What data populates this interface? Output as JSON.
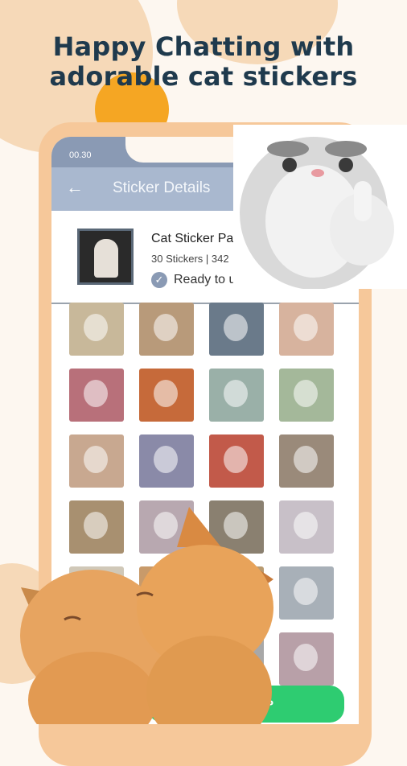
{
  "headline": {
    "line1": "Happy Chatting with",
    "line2": "adorable cat stickers"
  },
  "status": {
    "time": "00.30"
  },
  "appbar": {
    "back_icon": "←",
    "title": "Sticker Details"
  },
  "pack": {
    "name": "Cat Sticker Pa",
    "meta": "30 Stickers | 342",
    "ready": "Ready to u"
  },
  "button": {
    "label": "PP"
  },
  "colors": {
    "accent": "#2ecc71",
    "phone": "#f6c89a",
    "appbar": "#a9b8cf",
    "headline": "#1f3a4d"
  },
  "stickers": [
    {
      "color": "#c8b89a"
    },
    {
      "color": "#b89a7a"
    },
    {
      "color": "#6a7a8a"
    },
    {
      "color": "#d7b39e"
    },
    {
      "color": "#b8707a"
    },
    {
      "color": "#c66a3a"
    },
    {
      "color": "#9ab0a8"
    },
    {
      "color": "#a4b89a"
    },
    {
      "color": "#c8a890"
    },
    {
      "color": "#8a8aa8"
    },
    {
      "color": "#c25a4a"
    },
    {
      "color": "#9a8a7a"
    },
    {
      "color": "#a89070"
    },
    {
      "color": "#b8a8b0"
    },
    {
      "color": "#8a8070"
    },
    {
      "color": "#c8c0c8"
    },
    {
      "color": "#d0c8b8"
    },
    {
      "color": "#c89a6a"
    },
    {
      "color": "#b89a70"
    },
    {
      "color": "#a8b0b8"
    },
    {
      "color": "#e0d8d0"
    },
    {
      "color": "#c8a880"
    },
    {
      "color": "#a8a8a8"
    },
    {
      "color": "#b8a0a8"
    }
  ]
}
